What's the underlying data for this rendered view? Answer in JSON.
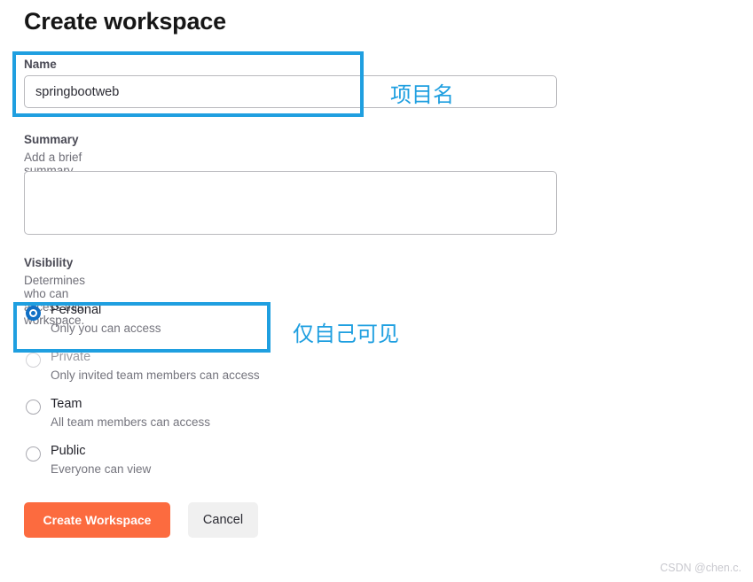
{
  "page": {
    "title": "Create workspace"
  },
  "name_field": {
    "label": "Name",
    "value": "springbootweb",
    "placeholder": ""
  },
  "summary_field": {
    "label": "Summary",
    "help": "Add a brief summary about this workspace.",
    "value": "",
    "placeholder": ""
  },
  "visibility": {
    "label": "Visibility",
    "help": "Determines who can access this workspace.",
    "selected": "Personal",
    "options": [
      {
        "title": "Personal",
        "desc": "Only you can access",
        "selected": true,
        "disabled": false
      },
      {
        "title": "Private",
        "desc": "Only invited team members can access",
        "selected": false,
        "disabled": true
      },
      {
        "title": "Team",
        "desc": "All team members can access",
        "selected": false,
        "disabled": false
      },
      {
        "title": "Public",
        "desc": "Everyone can view",
        "selected": false,
        "disabled": false
      }
    ]
  },
  "buttons": {
    "primary": "Create Workspace",
    "secondary": "Cancel"
  },
  "annotations": [
    {
      "text": "项目名",
      "target": "name-field"
    },
    {
      "text": "仅自己可见",
      "target": "visibility-personal"
    }
  ],
  "watermark": "CSDN @chen.c.",
  "colors": {
    "primary_button": "#fc6b3f",
    "annotation_blue": "#1f9fe0",
    "radio_selected": "#0f6fc5",
    "input_border": "#b9b9bd"
  }
}
